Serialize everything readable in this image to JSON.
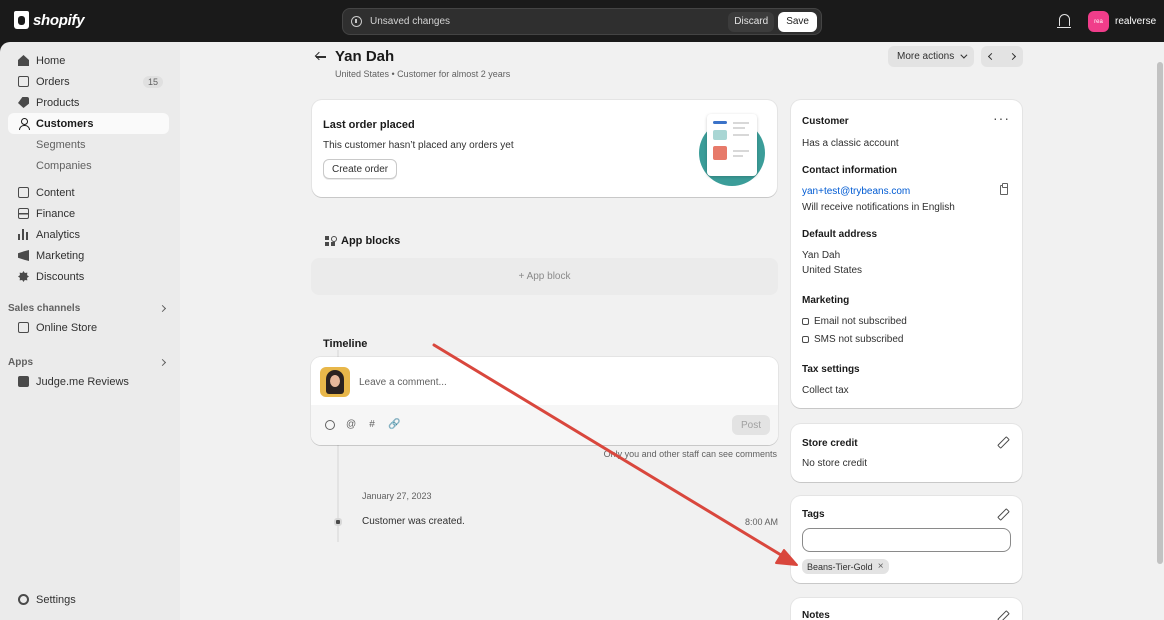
{
  "topbar": {
    "logo_text": "shopify",
    "unsaved_message": "Unsaved changes",
    "discard_label": "Discard",
    "save_label": "Save",
    "store_avatar_text": "rea",
    "store_name": "realverse"
  },
  "sidebar": {
    "items": [
      {
        "label": "Home",
        "icon": "home-icon"
      },
      {
        "label": "Orders",
        "icon": "orders-icon",
        "badge": "15"
      },
      {
        "label": "Products",
        "icon": "tag-icon"
      },
      {
        "label": "Customers",
        "icon": "person-icon",
        "active": true
      },
      {
        "label": "Segments"
      },
      {
        "label": "Companies"
      },
      {
        "label": "Content",
        "icon": "content-icon"
      },
      {
        "label": "Finance",
        "icon": "finance-icon"
      },
      {
        "label": "Analytics",
        "icon": "analytics-icon"
      },
      {
        "label": "Marketing",
        "icon": "marketing-icon"
      },
      {
        "label": "Discounts",
        "icon": "discount-icon"
      }
    ],
    "sales_channels_heading": "Sales channels",
    "online_store": "Online Store",
    "apps_heading": "Apps",
    "judgeme": "Judge.me Reviews",
    "settings": "Settings"
  },
  "page": {
    "title": "Yan Dah",
    "subtitle": "United States • Customer for almost 2 years",
    "more_actions": "More actions"
  },
  "last_order": {
    "heading": "Last order placed",
    "text": "This customer hasn’t placed any orders yet",
    "button": "Create order"
  },
  "app_blocks": {
    "heading": "App blocks",
    "add_label": "+ App block"
  },
  "timeline": {
    "heading": "Timeline",
    "comment_placeholder": "Leave a comment...",
    "post_label": "Post",
    "hint": "Only you and other staff can see comments",
    "date": "January 27, 2023",
    "event": "Customer was created.",
    "time": "8:00 AM"
  },
  "customer_card": {
    "heading": "Customer",
    "account": "Has a classic account",
    "contact_heading": "Contact information",
    "email": "yan+test@trybeans.com",
    "notifications": "Will receive notifications in English",
    "address_heading": "Default address",
    "address_name": "Yan Dah",
    "address_country": "United States",
    "marketing_heading": "Marketing",
    "email_status": "Email not subscribed",
    "sms_status": "SMS not subscribed",
    "tax_heading": "Tax settings",
    "tax_value": "Collect tax"
  },
  "store_credit": {
    "heading": "Store credit",
    "value": "No store credit"
  },
  "tags": {
    "heading": "Tags",
    "input_value": "",
    "chip": "Beans-Tier-Gold"
  },
  "notes": {
    "heading": "Notes"
  },
  "colors": {
    "topbar": "#1a1a1a",
    "sidebar": "#ebebeb",
    "main_bg": "#f1f1f1",
    "link": "#005bd3",
    "arrow": "#d9473d",
    "store_avatar": "#f03d8a",
    "illustration_teal": "#3b9d99"
  }
}
